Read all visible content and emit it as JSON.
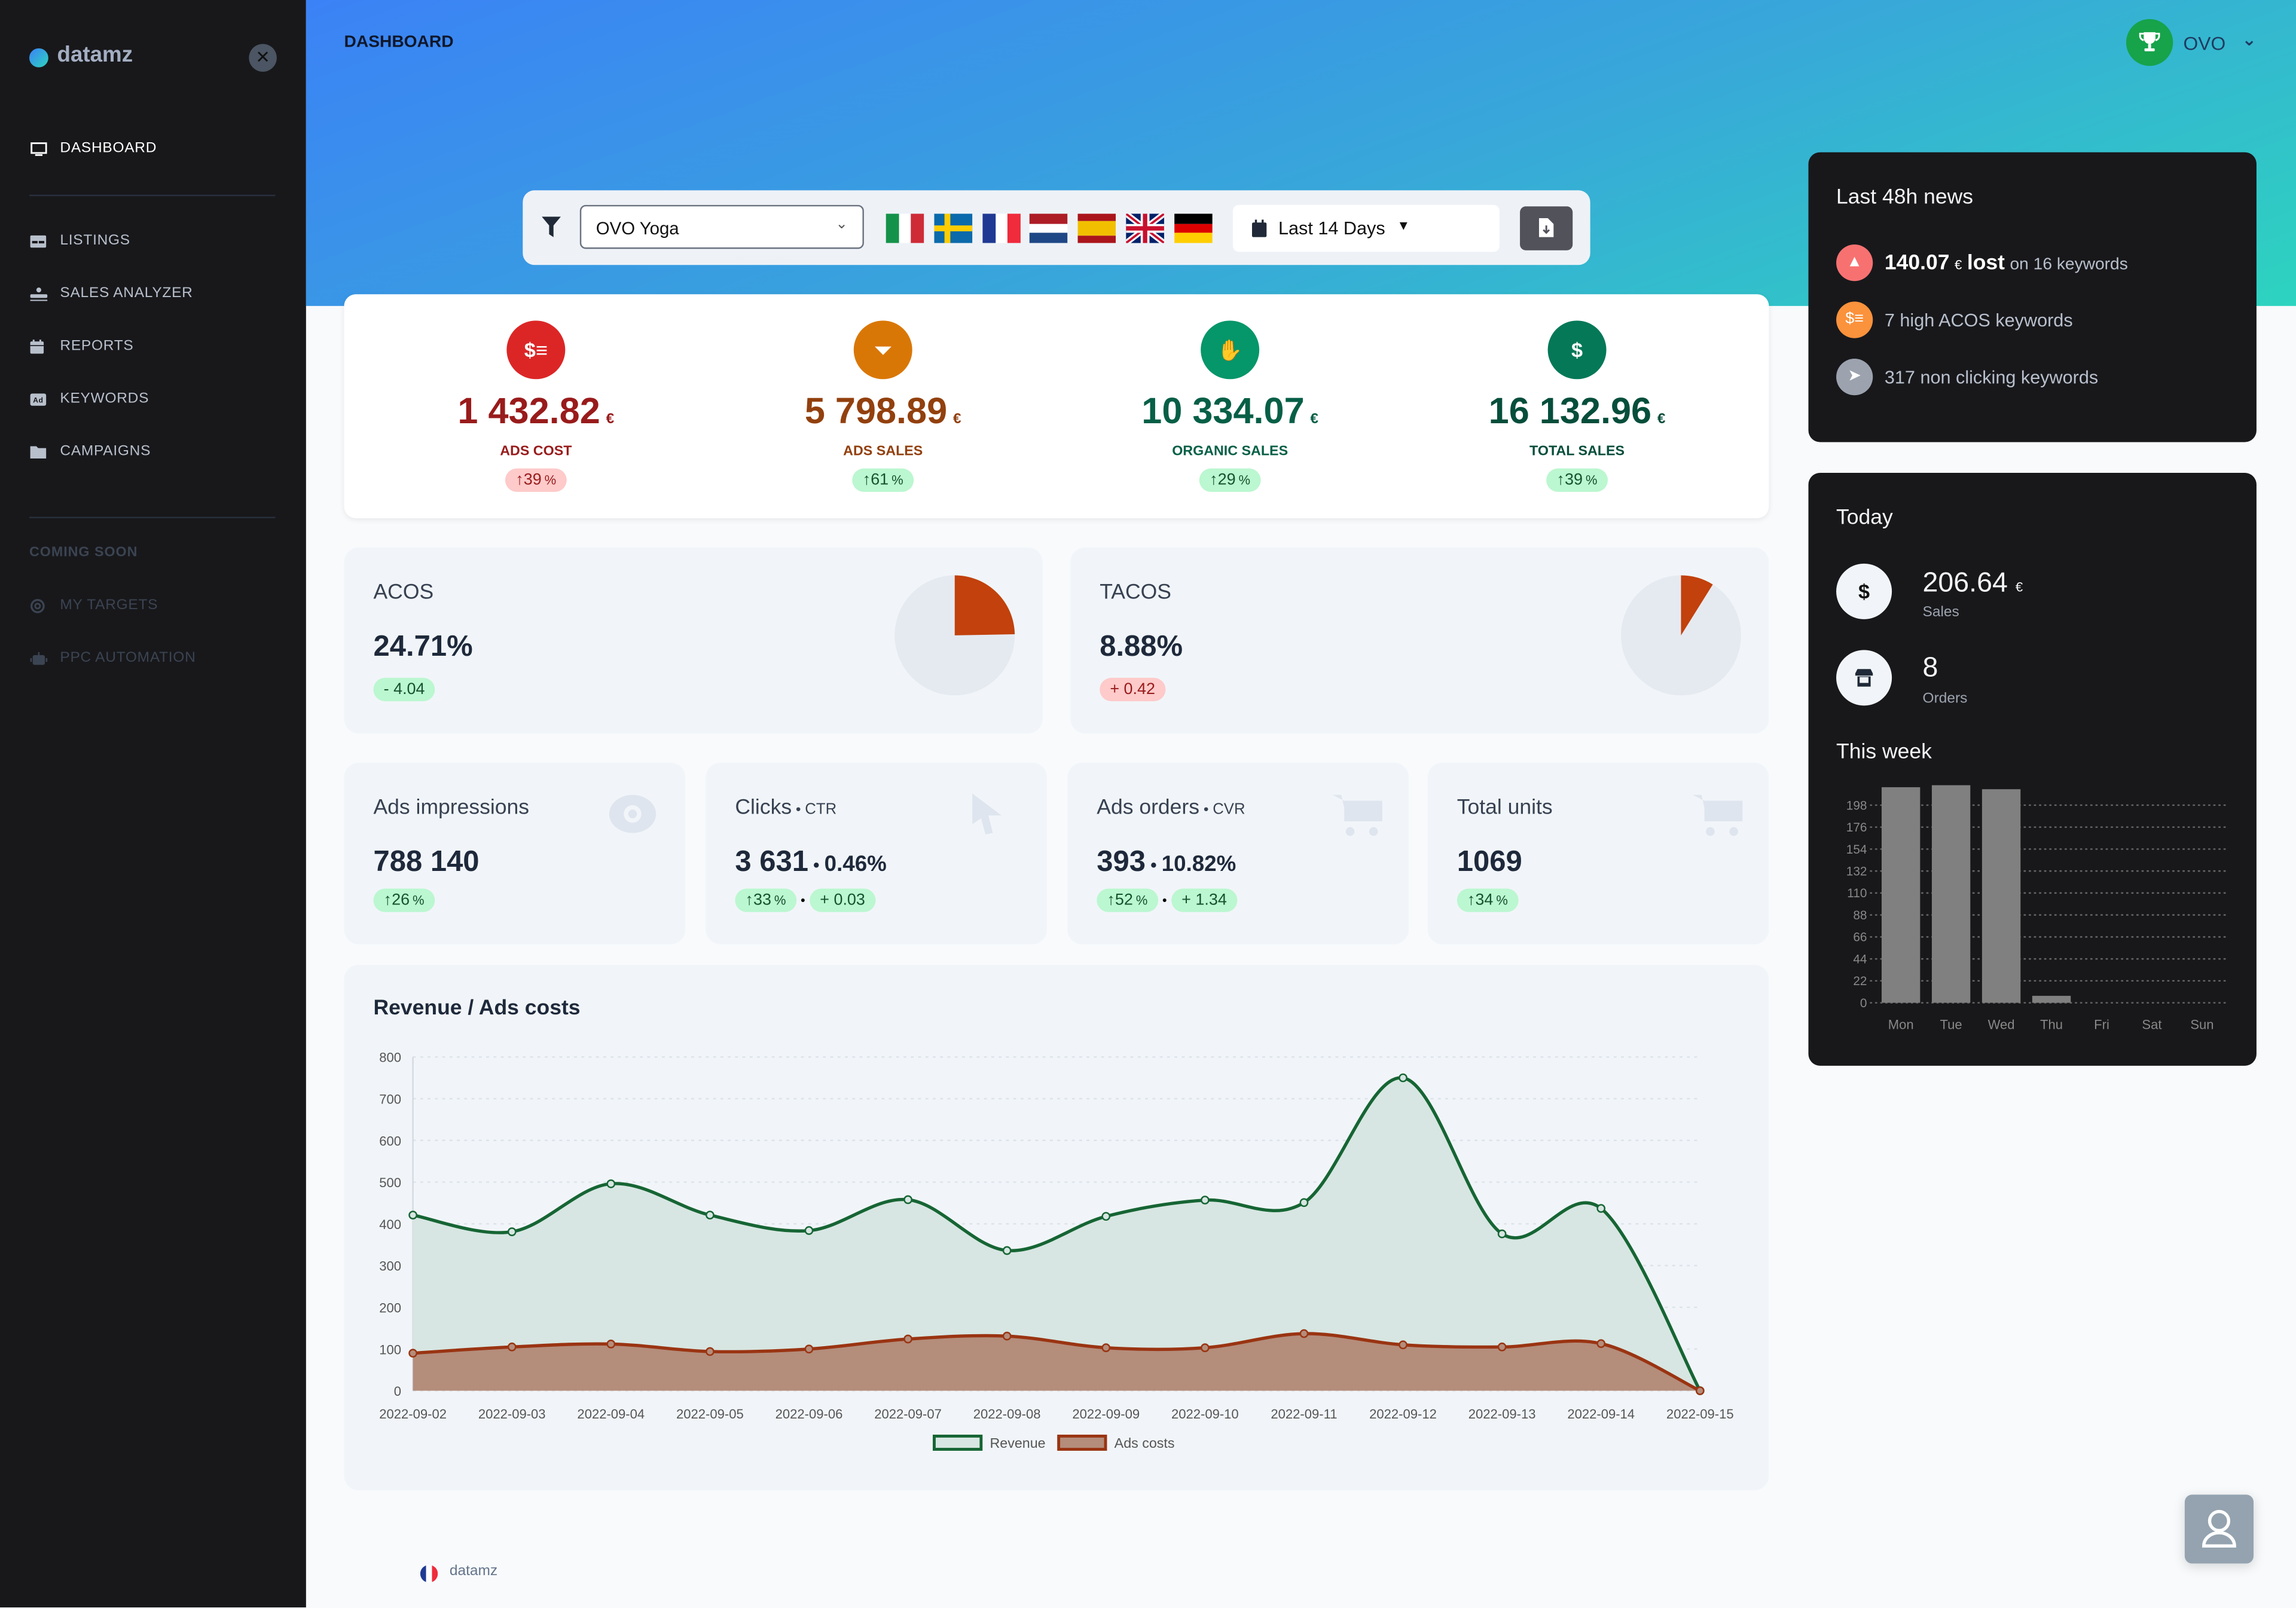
{
  "app": {
    "name": "datamz"
  },
  "sidebar": {
    "close_icon": "close-icon",
    "items": [
      {
        "label": "DASHBOARD",
        "icon": "monitor-icon",
        "active": true
      },
      {
        "label": "LISTINGS",
        "icon": "table-icon"
      },
      {
        "label": "SALES ANALYZER",
        "icon": "sales-analyzer-icon"
      },
      {
        "label": "REPORTS",
        "icon": "calendar-icon"
      },
      {
        "label": "KEYWORDS",
        "icon": "ad-icon"
      },
      {
        "label": "CAMPAIGNS",
        "icon": "folder-icon"
      }
    ],
    "coming_soon_label": "COMING SOON",
    "coming_soon_items": [
      {
        "label": "MY TARGETS",
        "icon": "target-icon"
      },
      {
        "label": "PPC AUTOMATION",
        "icon": "robot-icon"
      }
    ]
  },
  "header": {
    "title": "DASHBOARD",
    "user": {
      "name": "OVO",
      "icon": "trophy-icon",
      "badge_color": "#16a34a"
    }
  },
  "filters": {
    "account_select": {
      "value": "OVO Yoga"
    },
    "marketplaces": [
      "Italy",
      "Sweden",
      "France",
      "Netherlands",
      "Spain",
      "United Kingdom",
      "Germany"
    ],
    "date_range": {
      "value": "Last 14 Days"
    },
    "export_icon": "file-export-icon"
  },
  "kpis": [
    {
      "value": "1 432.82",
      "currency": "€",
      "label": "ADS COST",
      "change": "39",
      "unit": "%",
      "trend": "up",
      "status": "bad",
      "color": "#991b1b",
      "icon_bg": "#dc2626",
      "icon": "money-check-icon"
    },
    {
      "value": "5 798.89",
      "currency": "€",
      "label": "ADS SALES",
      "change": "61",
      "unit": "%",
      "trend": "up",
      "status": "good",
      "color": "#92400e",
      "icon_bg": "#d97706",
      "icon": "funnel-dollar-icon"
    },
    {
      "value": "10 334.07",
      "currency": "€",
      "label": "ORGANIC SALES",
      "change": "29",
      "unit": "%",
      "trend": "up",
      "status": "good",
      "color": "#065f46",
      "icon_bg": "#059669",
      "icon": "hand-holding-dollar-icon"
    },
    {
      "value": "16 132.96",
      "currency": "€",
      "label": "TOTAL SALES",
      "change": "39",
      "unit": "%",
      "trend": "up",
      "status": "good",
      "color": "#064e3b",
      "icon_bg": "#047857",
      "icon": "dollar-icon"
    }
  ],
  "ratios": [
    {
      "title": "ACOS",
      "value": "24.71%",
      "delta": "- 4.04",
      "status": "good",
      "share": 0.2471
    },
    {
      "title": "TACOS",
      "value": "8.88%",
      "delta": "+ 0.42",
      "status": "bad",
      "share": 0.0888
    }
  ],
  "metrics": [
    {
      "title": "Ads impressions",
      "subtitle": "",
      "value": "788 140",
      "value2": "",
      "change": "26",
      "unit": "%",
      "delta2": "",
      "icon": "eye-icon"
    },
    {
      "title": "Clicks",
      "subtitle": "CTR",
      "value": "3 631",
      "value2": "0.46%",
      "change": "33",
      "unit": "%",
      "delta2": "+ 0.03",
      "icon": "cursor-icon"
    },
    {
      "title": "Ads orders",
      "subtitle": "CVR",
      "value": "393",
      "value2": "10.82%",
      "change": "52",
      "unit": "%",
      "delta2": "+ 1.34",
      "icon": "cart-icon"
    },
    {
      "title": "Total units",
      "subtitle": "",
      "value": "1069",
      "value2": "",
      "change": "34",
      "unit": "%",
      "delta2": "",
      "icon": "cart-icon"
    }
  ],
  "news": {
    "title": "Last 48h news",
    "items": [
      {
        "strong": "140.07",
        "currency": "€",
        "strong2": "lost",
        "text": "on 16 keywords",
        "icon": "warning-icon",
        "color": "#f87171"
      },
      {
        "text": "7 high ACOS keywords",
        "icon": "money-check-icon",
        "color": "#fb923c"
      },
      {
        "text": "317 non clicking keywords",
        "icon": "cursor-icon",
        "color": "#9ca3af"
      }
    ]
  },
  "today": {
    "title": "Today",
    "sales": {
      "value": "206.64",
      "currency": "€",
      "label": "Sales",
      "icon": "dollar-icon"
    },
    "orders": {
      "value": "8",
      "label": "Orders",
      "icon": "store-icon"
    },
    "week_title": "This week"
  },
  "footer": {
    "brand": "datamz",
    "flag": "France"
  },
  "help_button": {
    "icon": "user-icon"
  },
  "chart_data": [
    {
      "type": "area",
      "title": "Revenue / Ads costs",
      "x": [
        "2022-09-02",
        "2022-09-03",
        "2022-09-04",
        "2022-09-05",
        "2022-09-06",
        "2022-09-07",
        "2022-09-08",
        "2022-09-09",
        "2022-09-10",
        "2022-09-11",
        "2022-09-12",
        "2022-09-13",
        "2022-09-14",
        "2022-09-15"
      ],
      "series": [
        {
          "name": "Revenue",
          "color": "#166534",
          "fill": "#d7e6e2",
          "values": [
            421,
            381,
            496,
            421,
            384,
            458,
            336,
            418,
            457,
            451,
            750,
            376,
            437,
            0
          ]
        },
        {
          "name": "Ads costs",
          "color": "#9a3412",
          "fill": "#b48d7b",
          "values": [
            90,
            105,
            112,
            94,
            100,
            124,
            131,
            103,
            103,
            137,
            110,
            105,
            113,
            0
          ]
        }
      ],
      "yticks": [
        0,
        100,
        200,
        300,
        400,
        500,
        600,
        700,
        800
      ],
      "ylim": [
        0,
        800
      ],
      "xlabel": "",
      "ylabel": "",
      "grid": true,
      "legend": "bottom"
    },
    {
      "type": "bar",
      "title": "This week",
      "categories": [
        "Mon",
        "Tue",
        "Wed",
        "Thu",
        "Fri",
        "Sat",
        "Sun"
      ],
      "values": [
        216,
        218,
        214,
        7,
        0,
        0,
        0
      ],
      "yticks": [
        0,
        22,
        44,
        66,
        88,
        110,
        132,
        154,
        176,
        198
      ],
      "ylim": [
        0,
        220
      ],
      "grid": true
    }
  ]
}
